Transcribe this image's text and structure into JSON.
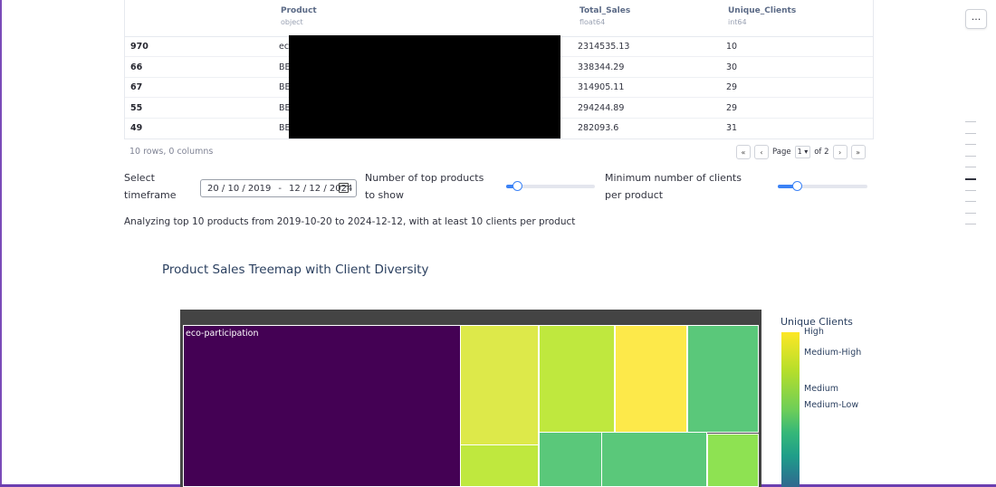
{
  "table": {
    "columns": [
      {
        "name": "Product",
        "dtype": "object"
      },
      {
        "name": "Total_Sales",
        "dtype": "float64"
      },
      {
        "name": "Unique_Clients",
        "dtype": "int64"
      }
    ],
    "rows": [
      {
        "index": "970",
        "product": "eco",
        "sales": "2314535.13",
        "clients": "10"
      },
      {
        "index": "66",
        "product": "BE",
        "sales": "338344.29",
        "clients": "30"
      },
      {
        "index": "67",
        "product": "BE",
        "sales": "314905.11",
        "clients": "29"
      },
      {
        "index": "55",
        "product": "BE",
        "sales": "294244.89",
        "clients": "29"
      },
      {
        "index": "49",
        "product": "BE",
        "sales": "282093.6",
        "clients": "31"
      }
    ],
    "summary": "10 rows, 0 columns",
    "pagination": {
      "page_label": "Page",
      "page": "1",
      "of_label": "of 2",
      "first": "«",
      "prev": "‹",
      "next": "›",
      "last": "»"
    }
  },
  "menu_button": "···",
  "controls": {
    "timeframe_label": "Select timeframe",
    "date_start": "20 / 10 / 2019",
    "date_sep": "-",
    "date_end": "12 / 12 / 2024",
    "top_products_label": "Number of top products to show",
    "top_products_value": 0.05,
    "min_clients_label": "Minimum number of clients per product",
    "min_clients_value": 0.08
  },
  "analysis_text": "Analyzing top 10 products from 2019-10-20 to 2024-12-12, with at least 10 clients per product",
  "chart": {
    "title": "Product Sales Treemap with Client Diversity",
    "legend_title": "Unique Clients",
    "colorbar_labels": [
      "High",
      "Medium-High",
      "Medium",
      "Medium-Low"
    ],
    "tiles": [
      {
        "label": "eco-participation",
        "color": "#440154"
      },
      {
        "label": "",
        "color": "#dde94a"
      },
      {
        "label": "",
        "color": "#bfe83e"
      },
      {
        "label": "",
        "color": "#fde94a"
      },
      {
        "label": "",
        "color": "#5ac87a"
      },
      {
        "label": "",
        "color": "#bfe83e"
      },
      {
        "label": "",
        "color": "#5ac87a"
      },
      {
        "label": "",
        "color": "#5ac87a"
      },
      {
        "label": "",
        "color": "#8ee252"
      }
    ]
  },
  "colors": {
    "accent": "#3b82f6",
    "chart_bg": "#444444"
  }
}
